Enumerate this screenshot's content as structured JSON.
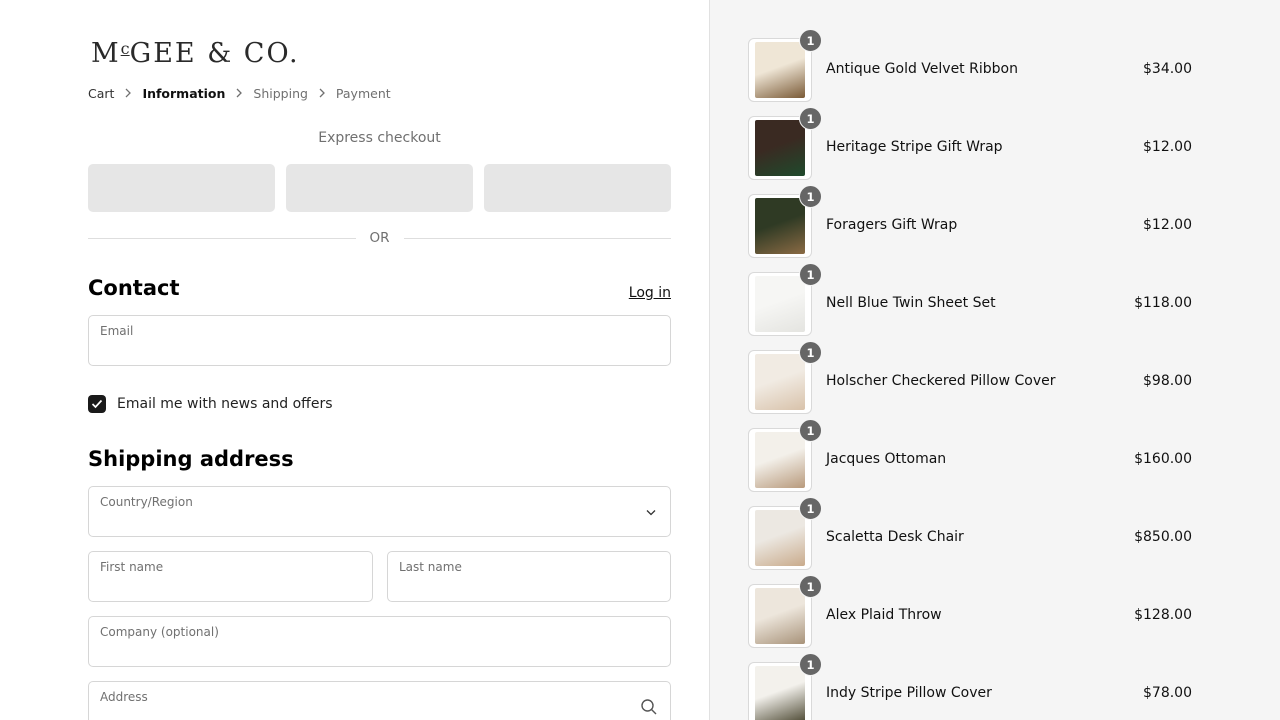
{
  "brand": {
    "logo_main": "MCGEE & CO.",
    "logo_text_a": "M",
    "logo_text_sup": "c",
    "logo_text_b": "GEE & CO."
  },
  "breadcrumb": [
    {
      "label": "Cart"
    },
    {
      "label": "Information"
    },
    {
      "label": "Shipping"
    },
    {
      "label": "Payment"
    }
  ],
  "express": {
    "title": "Express checkout",
    "divider": "OR"
  },
  "contact": {
    "heading": "Contact",
    "login_link": "Log in",
    "email_label": "Email",
    "newsletter_label": "Email me with news and offers",
    "newsletter_checked": true
  },
  "shipping": {
    "heading": "Shipping address",
    "country_label": "Country/Region",
    "first_name_label": "First name",
    "last_name_label": "Last name",
    "company_label": "Company (optional)",
    "address_label": "Address"
  },
  "cart_items": [
    {
      "name": "Antique Gold Velvet Ribbon",
      "price": "$34.00",
      "qty": "1",
      "colors": [
        "#efe6d6",
        "#7a5a36"
      ]
    },
    {
      "name": "Heritage Stripe Gift Wrap",
      "price": "$12.00",
      "qty": "1",
      "colors": [
        "#3a2a22",
        "#1f4a2c"
      ]
    },
    {
      "name": "Foragers Gift Wrap",
      "price": "$12.00",
      "qty": "1",
      "colors": [
        "#2f3a24",
        "#8a6a44"
      ]
    },
    {
      "name": "Nell Blue Twin Sheet Set",
      "price": "$118.00",
      "qty": "1",
      "colors": [
        "#f6f6f4",
        "#e4e4e0"
      ]
    },
    {
      "name": "Holscher Checkered Pillow Cover",
      "price": "$98.00",
      "qty": "1",
      "colors": [
        "#f1ebe3",
        "#d8c2aa"
      ]
    },
    {
      "name": "Jacques Ottoman",
      "price": "$160.00",
      "qty": "1",
      "colors": [
        "#f3f0ea",
        "#b89a7c"
      ]
    },
    {
      "name": "Scaletta Desk Chair",
      "price": "$850.00",
      "qty": "1",
      "colors": [
        "#ece8e2",
        "#c9ab8c"
      ]
    },
    {
      "name": "Alex Plaid Throw",
      "price": "$128.00",
      "qty": "1",
      "colors": [
        "#ede6dc",
        "#a8937a"
      ]
    },
    {
      "name": "Indy Stripe Pillow Cover",
      "price": "$78.00",
      "qty": "1",
      "colors": [
        "#f3f1ec",
        "#4e4a34"
      ]
    }
  ]
}
